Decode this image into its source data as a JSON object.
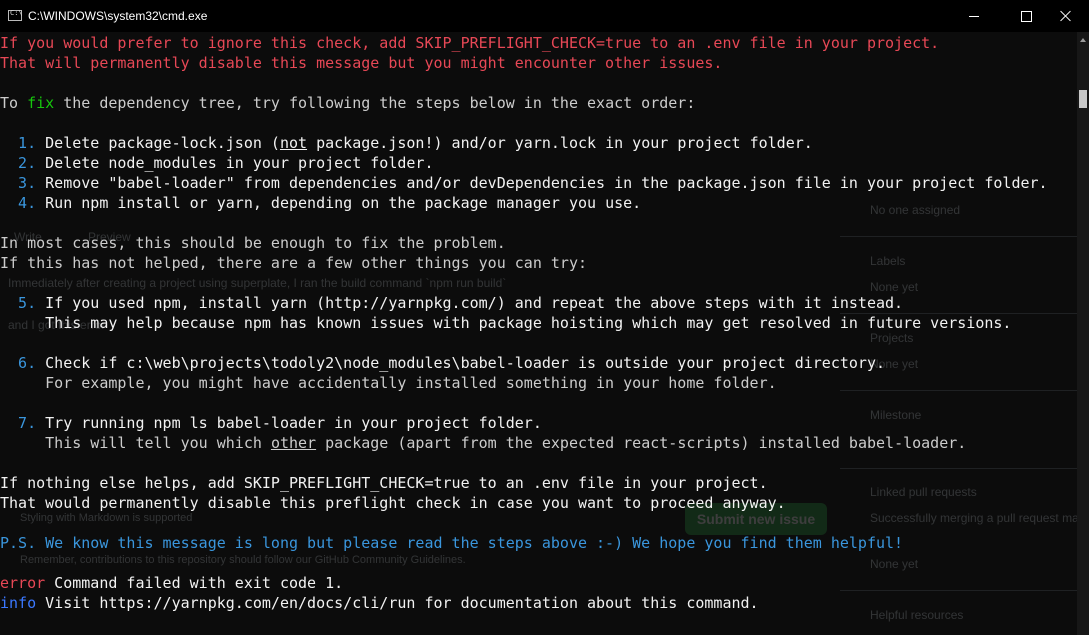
{
  "window": {
    "title": "C:\\WINDOWS\\system32\\cmd.exe"
  },
  "console": {
    "warning1": "If you would prefer to ignore this check, add SKIP_PREFLIGHT_CHECK=true to an .env file in your project.",
    "warning2": "That will permanently disable this message but you might encounter other issues.",
    "fix_pre": "To ",
    "fix_word": "fix",
    "fix_post": " the dependency tree, try following the steps below in the exact order:",
    "s1_num": "  1.",
    "s1_a": " Delete package-lock.json (",
    "s1_not": "not",
    "s1_b": " package.json!) and/or yarn.lock in your project folder.",
    "s2_num": "  2.",
    "s2_text": " Delete node_modules in your project folder.",
    "s3_num": "  3.",
    "s3_text": " Remove \"babel-loader\" from dependencies and/or devDependencies in the package.json file in your project folder.",
    "s4_num": "  4.",
    "s4_text": " Run npm install or yarn, depending on the package manager you use.",
    "most1": "In most cases, this should be enough to fix the problem.",
    "most2": "If this has not helped, there are a few other things you can try:",
    "s5_num": "  5.",
    "s5_text": " If you used npm, install yarn (http://yarnpkg.com/) and repeat the above steps with it instead.",
    "s5_line2": "     This may help because npm has known issues with package hoisting which may get resolved in future versions.",
    "s6_num": "  6.",
    "s6_text": " Check if c:\\web\\projects\\todoly2\\node_modules\\babel-loader is outside your project directory.",
    "s6_line2": "     For example, you might have accidentally installed something in your home folder.",
    "s7_num": "  7.",
    "s7_text": " Try running npm ls babel-loader in your project folder.",
    "s7_line2_a": "     This will tell you which ",
    "s7_other": "other",
    "s7_line2_b": " package (apart from the expected react-scripts) installed babel-loader.",
    "else1": "If nothing else helps, add SKIP_PREFLIGHT_CHECK=true to an .env file in your project.",
    "else2": "That would permanently disable this preflight check in case you want to proceed anyway.",
    "ps": "P.S. We know this message is long but please read the steps above :-) We hope you find them helpful!",
    "error_tag": "error",
    "error_text": " Command failed with exit code 1.",
    "info_tag": "info",
    "info_text": " Visit https://yarnpkg.com/en/docs/cli/run for documentation about this command."
  },
  "background_page": {
    "write_tab": "Write",
    "preview_tab": "Preview",
    "comment_line1": "Immediately after creating a project using superplate, I ran the build command `npm run build`",
    "comment_line2": "and I got this error",
    "markdown_note": "Styling with Markdown is supported",
    "guidelines_note": "Remember, contributions to this repository should follow our GitHub Community Guidelines.",
    "submit_button": "Submit new issue",
    "no_one_assigned": "No one assigned",
    "labels_heading": "Labels",
    "none_yet_1": "None yet",
    "projects_heading": "Projects",
    "none_yet_2": "None yet",
    "milestone_heading": "Milestone",
    "linked_heading": "Linked pull requests",
    "linked_note": "Successfully merging a pull request may",
    "none_yet_3": "None yet",
    "helpful_heading": "Helpful resources"
  },
  "colors": {
    "background": "#0c0c0c",
    "default_text": "#cccccc",
    "red": "#e74856",
    "green": "#16c60c",
    "blue": "#3b78ff",
    "cyan": "#3a96dd"
  }
}
